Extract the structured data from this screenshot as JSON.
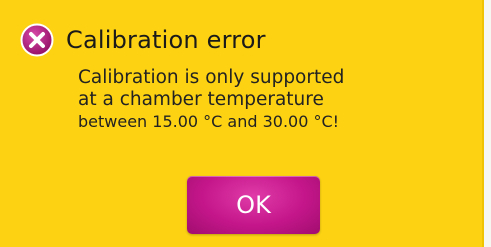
{
  "dialog": {
    "icon": "error-x-icon",
    "title": "Calibration error",
    "message_lines": [
      "Calibration is only supported",
      "at a chamber temperature",
      "between 15.00 °C and 30.00 °C!"
    ],
    "ok_label": "OK"
  },
  "colors": {
    "background": "#fcd213",
    "button": "#c4168a",
    "icon": "#b0157a"
  }
}
